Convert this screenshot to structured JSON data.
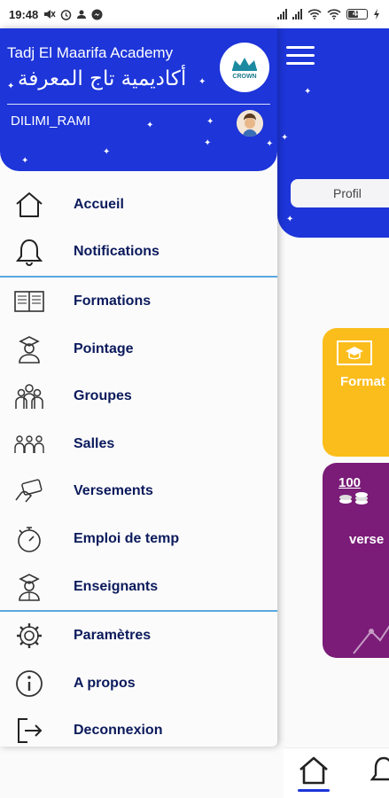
{
  "status_bar": {
    "time": "19:48",
    "battery": "48"
  },
  "drawer": {
    "academy_name": "Tadj El Maarifa Academy",
    "academy_name_ar": "أكاديمية تاج المعرفة",
    "logo_text": "CROWN",
    "username": "DILIMI_RAMI",
    "menu_group_1": [
      {
        "label": "Accueil",
        "icon": "home-icon"
      },
      {
        "label": "Notifications",
        "icon": "bell-icon"
      }
    ],
    "menu_group_2": [
      {
        "label": "Formations",
        "icon": "book-icon"
      },
      {
        "label": "Pointage",
        "icon": "graduate-icon"
      },
      {
        "label": "Groupes",
        "icon": "group-icon"
      },
      {
        "label": "Salles",
        "icon": "classroom-icon"
      },
      {
        "label": "Versements",
        "icon": "payment-icon"
      },
      {
        "label": "Emploi de temp",
        "icon": "stopwatch-icon"
      },
      {
        "label": "Enseignants",
        "icon": "teacher-icon"
      }
    ],
    "menu_group_3": [
      {
        "label": "Paramètres",
        "icon": "gear-icon"
      },
      {
        "label": "A propos",
        "icon": "info-icon"
      },
      {
        "label": "Deconnexion",
        "icon": "logout-icon"
      }
    ]
  },
  "background": {
    "profil_label": "Profil",
    "card_1_label": "Format",
    "card_2_label": "verse",
    "card_2_amount": "100"
  },
  "colors": {
    "primary": "#1d35d9",
    "card_yellow": "#fbbd1c",
    "card_purple": "#7a1c78",
    "menu_text": "#0b1a5c",
    "separator": "#5aa7e0"
  }
}
